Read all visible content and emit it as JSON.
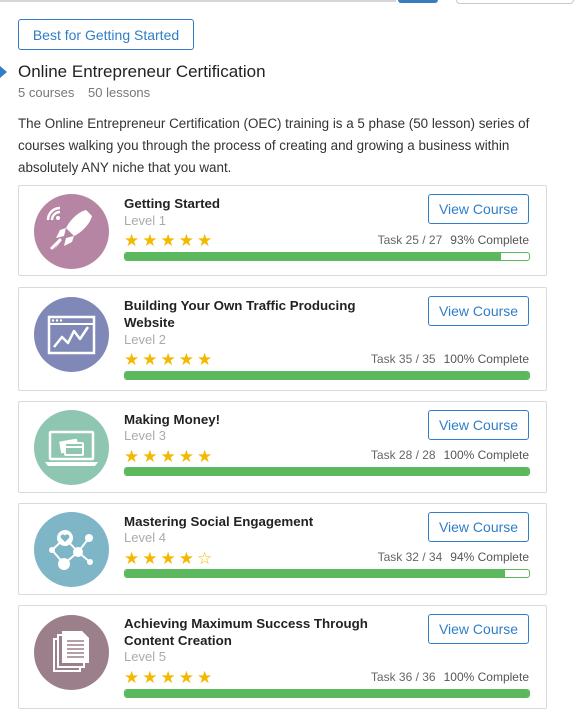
{
  "filter_button_label": "Best for Getting Started",
  "certification": {
    "title": "Online Entrepreneur Certification",
    "courses_count": "5 courses",
    "lessons_count": "50 lessons",
    "description": "The Online Entrepreneur Certification (OEC) training is a 5 phase (50 lesson) series of courses walking you through the process of creating and growing a business within absolutely ANY niche that you want."
  },
  "view_button_label": "View Course",
  "colors": {
    "accent_blue": "#2f7ec7",
    "progress_green": "#5cb85c",
    "star_yellow": "#f5b800"
  },
  "courses": [
    {
      "title": "Getting Started",
      "level": "Level 1",
      "stars": "★★★★★",
      "task": "Task 25 / 27",
      "complete": "93% Complete",
      "progress_fraction": 0.93,
      "icon": "rocket-icon",
      "icon_color": "#b785a4"
    },
    {
      "title": "Building Your Own Traffic Producing Website",
      "level": "Level 2",
      "stars": "★★★★★",
      "task": "Task 35 / 35",
      "complete": "100% Complete",
      "progress_fraction": 1.0,
      "icon": "browser-chart-icon",
      "icon_color": "#7f88b6"
    },
    {
      "title": "Making Money!",
      "level": "Level 3",
      "stars": "★★★★★",
      "task": "Task 28 / 28",
      "complete": "100% Complete",
      "progress_fraction": 1.0,
      "icon": "laptop-payment-icon",
      "icon_color": "#8fc6b1"
    },
    {
      "title": "Mastering Social Engagement",
      "level": "Level 4",
      "stars": "★★★★☆",
      "task": "Task 32 / 34",
      "complete": "94% Complete",
      "progress_fraction": 0.94,
      "icon": "social-network-icon",
      "icon_color": "#7fb6c7"
    },
    {
      "title": "Achieving Maximum Success Through Content Creation",
      "level": "Level 5",
      "stars": "★★★★★",
      "task": "Task 36 / 36",
      "complete": "100% Complete",
      "progress_fraction": 1.0,
      "icon": "documents-icon",
      "icon_color": "#9b7f8a"
    }
  ]
}
